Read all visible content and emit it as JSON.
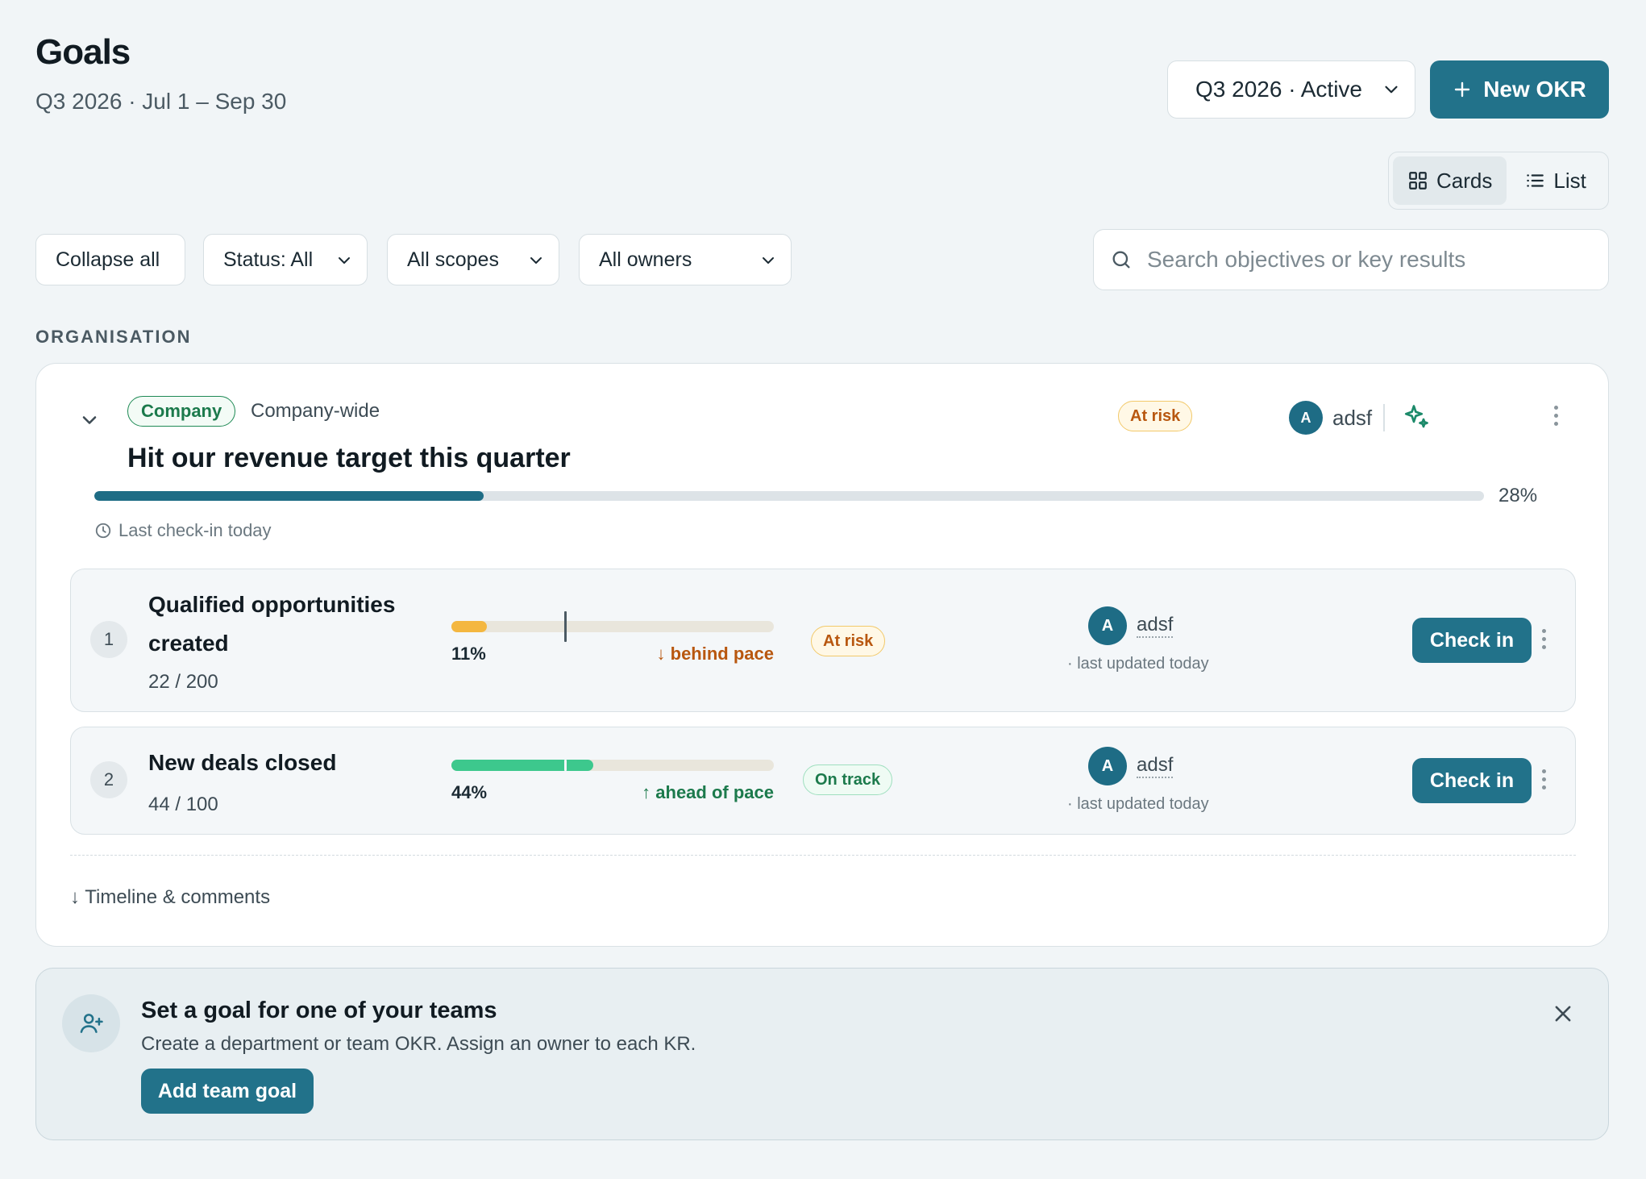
{
  "header": {
    "title": "Goals",
    "subtitle": "Q3 2026 · Jul 1 – Sep 30",
    "quarter_select": "Q3 2026 · Active",
    "new_okr_label": "New OKR"
  },
  "view_toggle": {
    "cards_label": "Cards",
    "list_label": "List",
    "active": "Cards"
  },
  "filters": {
    "collapse_label": "Collapse all",
    "status": "Status: All",
    "scopes": "All scopes",
    "owners": "All owners",
    "search_placeholder": "Search objectives or key results"
  },
  "section": {
    "label": "ORGANISATION"
  },
  "objective": {
    "scope_badge": "Company",
    "scope_text": "Company-wide",
    "title": "Hit our revenue target this quarter",
    "progress": 0.28,
    "progress_label": "28%",
    "last_checkin": "Last check-in today",
    "owner_initial": "A",
    "owner_name": "adsf",
    "status": "At risk",
    "icons": [
      "chevron-down-icon",
      "sparkle-icon",
      "clock-icon",
      "kebab-icon"
    ]
  },
  "key_results": [
    {
      "index": "1",
      "title_line1": "Qualified opportunities",
      "title_line2": "created",
      "count": "22 / 200",
      "progress": 0.11,
      "expected_pace": 0.35,
      "pct_label": "11%",
      "pace_text": "↓ behind pace",
      "status": "At risk",
      "owner_initial": "A",
      "owner_name": "adsf",
      "updated": "· last updated today",
      "checkin_label": "Check in",
      "color": "#f4b740"
    },
    {
      "index": "2",
      "title_line1": "New deals closed",
      "count": "44 / 100",
      "progress": 0.44,
      "expected_pace": 0.35,
      "pct_label": "44%",
      "pace_text": "↑ ahead of pace",
      "status": "On track",
      "owner_initial": "A",
      "owner_name": "adsf",
      "updated": "· last updated today",
      "checkin_label": "Check in",
      "color": "#3dc88d"
    }
  ],
  "timeline": {
    "label": "↓ Timeline & comments"
  },
  "team_prompt": {
    "title": "Set a goal for one of your teams",
    "description": "Create a department or team OKR. Assign an owner to each KR.",
    "button_label": "Add team goal",
    "icons": [
      "user-plus-icon",
      "close-icon"
    ]
  },
  "colors": {
    "accent": "#22728a",
    "progress": "#1e6c85",
    "at_risk": "#b8570f",
    "on_track": "#1c7a4c",
    "background": "#f1f5f7"
  }
}
